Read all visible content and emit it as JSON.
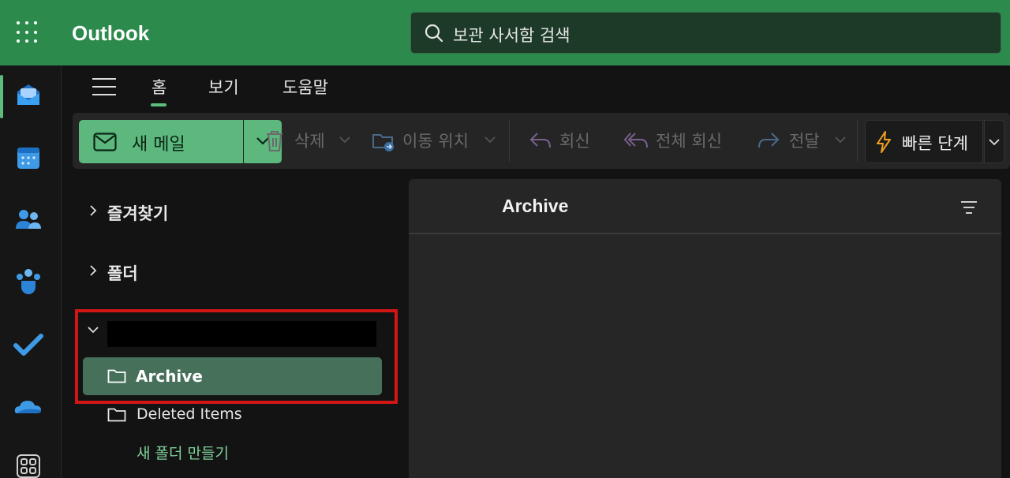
{
  "header": {
    "app_title": "Outlook",
    "search_placeholder": "보관 사서함 검색"
  },
  "rail": {
    "items": [
      {
        "name": "mail-icon",
        "color": "#2f8fe0"
      },
      {
        "name": "calendar-icon",
        "color": "#3f9ae6"
      },
      {
        "name": "people-icon",
        "color": "#3f9ae6"
      },
      {
        "name": "teams-icon",
        "color": "#3f9ae6"
      },
      {
        "name": "todo-icon",
        "color": "#3f9ae6"
      },
      {
        "name": "onedrive-icon",
        "color": "#3f9ae6"
      },
      {
        "name": "more-apps-icon",
        "color": "#cfcfcf"
      }
    ]
  },
  "tabs": [
    {
      "label": "홈",
      "active": true
    },
    {
      "label": "보기",
      "active": false
    },
    {
      "label": "도움말",
      "active": false
    }
  ],
  "commands": {
    "new_mail": "새 메일",
    "delete": "삭제",
    "move_to": "이동 위치",
    "reply": "회신",
    "reply_all": "전체 회신",
    "forward": "전달",
    "quick_steps": "빠른 단계"
  },
  "folders": {
    "favorites": "즐겨찾기",
    "folders": "폴더",
    "account_items": [
      {
        "label": "Archive",
        "selected": true
      },
      {
        "label": "Deleted Items",
        "selected": false
      }
    ],
    "new_folder": "새 폴더 만들기"
  },
  "message_list": {
    "title": "Archive"
  },
  "colors": {
    "brand": "#2b8a4c",
    "accent": "#5cb87c",
    "highlight_box": "#d21616"
  }
}
